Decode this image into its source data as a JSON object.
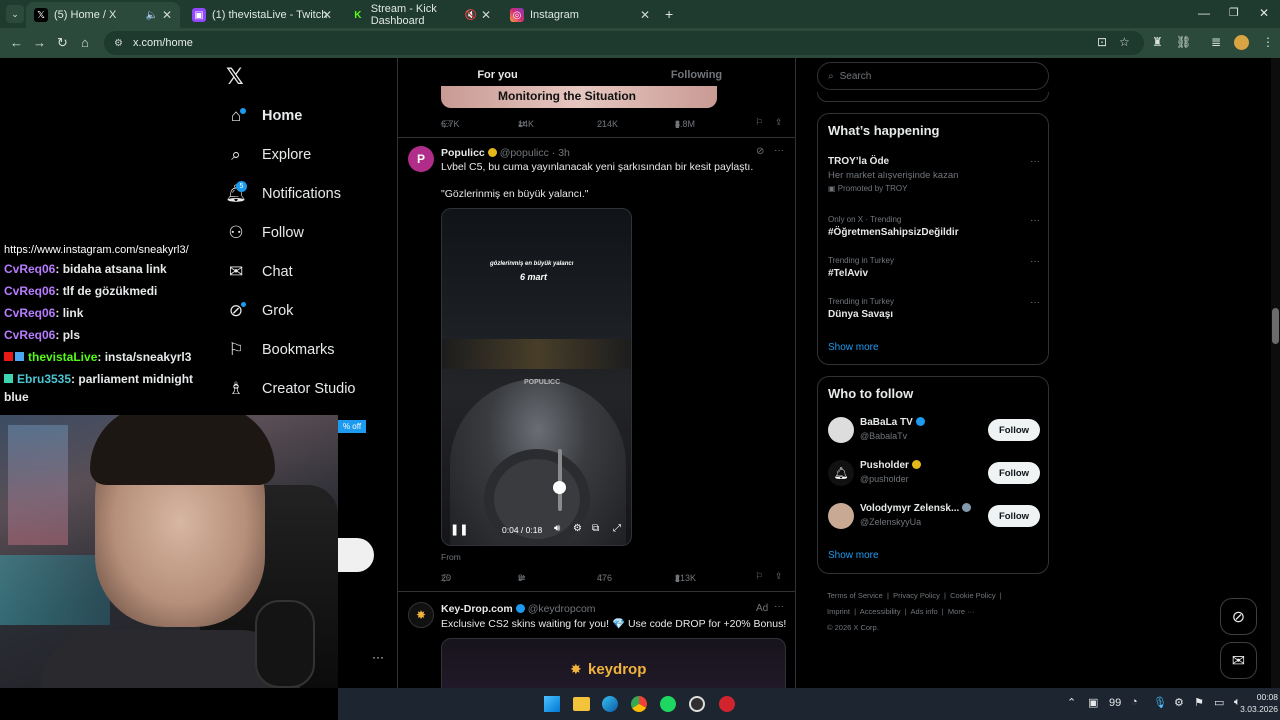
{
  "browser": {
    "tabs": [
      {
        "title": "(5) Home / X",
        "active": true
      },
      {
        "title": "(1) thevistaLive - Twitch"
      },
      {
        "title": "Stream - Kick Dashboard"
      },
      {
        "title": "Instagram"
      }
    ],
    "url": "x.com/home"
  },
  "nav": {
    "items": [
      {
        "label": "Home"
      },
      {
        "label": "Explore"
      },
      {
        "label": "Notifications",
        "badge": "5"
      },
      {
        "label": "Follow"
      },
      {
        "label": "Chat"
      },
      {
        "label": "Grok"
      },
      {
        "label": "Bookmarks"
      },
      {
        "label": "Creator Studio"
      }
    ]
  },
  "chat": {
    "partial_link": "https://www.instagram.com/sneakyrl3/",
    "messages": [
      {
        "user": "CvReq06",
        "text": ": bidaha atsana link"
      },
      {
        "user": "CvReq06",
        "text": ": tlf de gözükmedi"
      },
      {
        "user": "CvReq06",
        "text": ": link"
      },
      {
        "user": "CvReq06",
        "text": ": pls"
      },
      {
        "user": "thevistaLive",
        "text": ": insta/sneakyrl3"
      },
      {
        "user": "Ebru3535",
        "text": ": parliament midnight"
      }
    ],
    "wrap": "blue"
  },
  "promo_badge": "% off",
  "feed": {
    "tabs": {
      "for_you": "For you",
      "following": "Following"
    },
    "prev_post": {
      "banner": "Monitoring the Situation",
      "replies": "6.7K",
      "reposts": "14K",
      "likes": "214K",
      "views": "8.8M"
    },
    "post": {
      "name": "Populicc",
      "handle": "@populicc",
      "time": "· 3h",
      "text": "Lvbel C5, bu cuma yayınlanacak yeni şarkısından bir kesit paylaştı.",
      "quote": "\"Gözlerinmiş en büyük yalancı.\"",
      "video_caption_1": "gözlerinmiş en büyük yalancı",
      "video_caption_2": "6 mart",
      "watermark": "POPULICC",
      "time_code": "0:04 / 0:18",
      "from": "From",
      "replies": "20",
      "reposts": "9",
      "likes": "476",
      "views": "213K"
    },
    "ad": {
      "name": "Key-Drop.com",
      "handle": "@keydropcom",
      "label": "Ad",
      "text": "Exclusive CS2 skins waiting for you! 💎 Use code DROP for +20% Bonus!",
      "banner": "keydrop"
    }
  },
  "sidebar": {
    "search_placeholder": "Search",
    "happening_title": "What’s happening",
    "trends": [
      {
        "meta": "",
        "title": "TROY’la Öde",
        "sub": "Her market alışverişinde kazan",
        "promo": "Promoted by TROY"
      },
      {
        "meta": "Only on X · Trending",
        "title": "#ÖğretmenSahipsizDeğildir"
      },
      {
        "meta": "Trending in Turkey",
        "title": "#TelAviv"
      },
      {
        "meta": "Trending in Turkey",
        "title": "Dünya Savaşı"
      }
    ],
    "show_more": "Show more",
    "who_title": "Who to follow",
    "who": [
      {
        "name": "BaBaLa TV",
        "handle": "@BabalaTv",
        "button": "Follow"
      },
      {
        "name": "Pusholder",
        "handle": "@pusholder",
        "button": "Follow"
      },
      {
        "name": "Volodymyr Zelensk...",
        "handle": "@ZelenskyyUa",
        "button": "Follow"
      }
    ],
    "who_show_more": "Show more",
    "footer": {
      "row1": [
        "Terms of Service",
        "Privacy Policy",
        "Cookie Policy"
      ],
      "row2": [
        "Imprint",
        "Accessibility",
        "Ads info",
        "More ···"
      ],
      "copyright": "© 2026 X Corp."
    }
  },
  "taskbar": {
    "number": "99",
    "time": "00:08",
    "date": "3.03.2026"
  }
}
